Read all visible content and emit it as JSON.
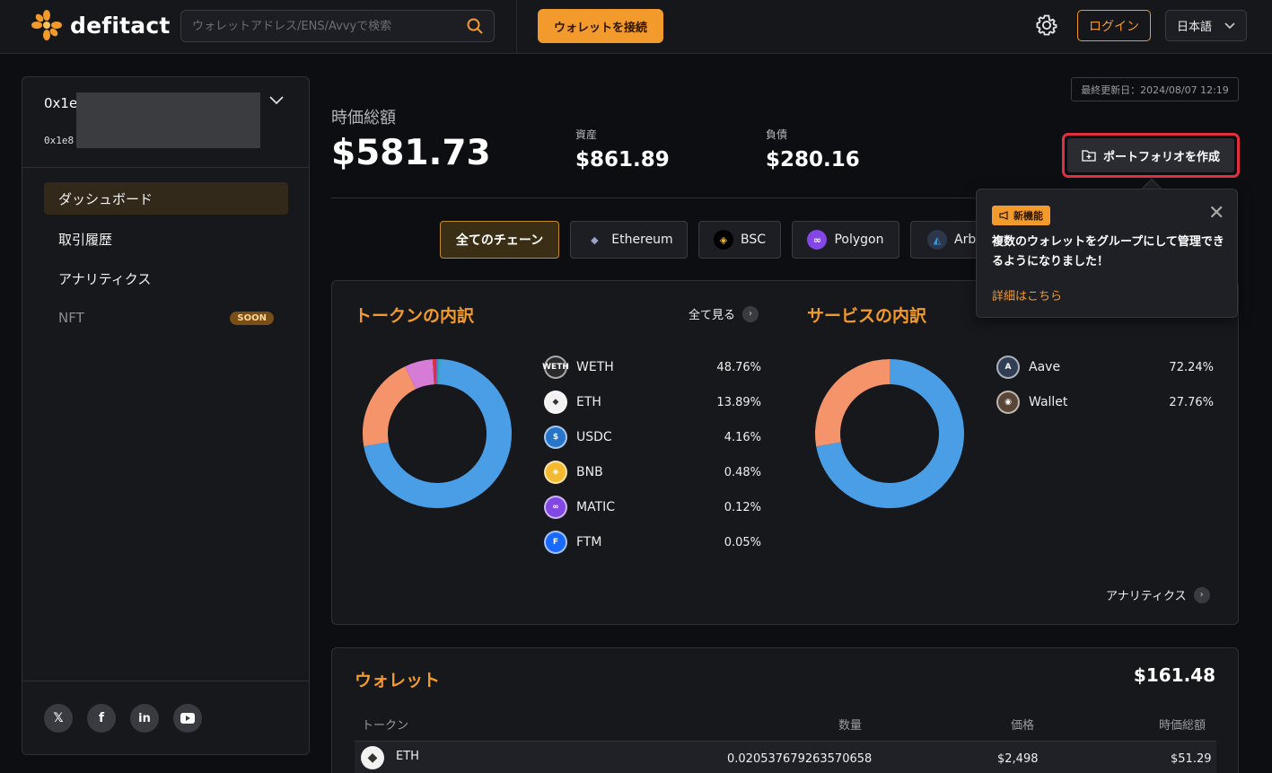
{
  "header": {
    "logo_text": "defitact",
    "search_placeholder": "ウォレットアドレス/ENS/Avvyで検索",
    "connect_label": "ウォレットを接続",
    "login_label": "ログイン",
    "language": "日本語"
  },
  "sidebar": {
    "address_short": "0x1e",
    "address_sub": "0x1e8",
    "items": [
      {
        "label": "ダッシュボード"
      },
      {
        "label": "取引履歴"
      },
      {
        "label": "アナリティクス"
      },
      {
        "label": "NFT",
        "badge": "SOON"
      }
    ],
    "social": [
      "x-icon",
      "facebook-icon",
      "linkedin-icon",
      "youtube-icon"
    ]
  },
  "summary": {
    "last_updated": "最終更新日：2024/08/07 12:19",
    "total_label": "時価総額",
    "total_value": "$581.73",
    "assets_label": "資産",
    "assets_value": "$861.89",
    "liabilities_label": "負債",
    "liabilities_value": "$280.16",
    "create_portfolio": "ポートフォリオを作成"
  },
  "chains": [
    {
      "label": "全てのチェーン",
      "active": true
    },
    {
      "label": "Ethereum",
      "icon": "ethereum-icon"
    },
    {
      "label": "BSC",
      "icon": "bnb-icon"
    },
    {
      "label": "Polygon",
      "icon": "polygon-icon"
    },
    {
      "label": "Arb",
      "icon": "arbitrum-icon"
    }
  ],
  "popup": {
    "badge": "新機能",
    "text": "複数のウォレットをグループにして管理できるようになりました！",
    "link": "詳細はこちら"
  },
  "token_breakdown": {
    "title": "トークンの内訳",
    "see_all": "全て見る",
    "footer_link": "アナリティクス",
    "items": [
      {
        "name": "WETH",
        "pct": "48.76%",
        "icon_text": "WETH",
        "color": "#2b2b2b"
      },
      {
        "name": "ETH",
        "pct": "13.89%",
        "icon_text": "◆",
        "color": "#f2f2f2"
      },
      {
        "name": "USDC",
        "pct": "4.16%",
        "icon_text": "$",
        "color": "#2775ca"
      },
      {
        "name": "BNB",
        "pct": "0.48%",
        "icon_text": "◈",
        "color": "#f3ba2f"
      },
      {
        "name": "MATIC",
        "pct": "0.12%",
        "icon_text": "∞",
        "color": "#8247e5"
      },
      {
        "name": "FTM",
        "pct": "0.05%",
        "icon_text": "F",
        "color": "#1969ff"
      }
    ]
  },
  "service_breakdown": {
    "title": "サービスの内訳",
    "items": [
      {
        "name": "Aave",
        "pct": "72.24%",
        "icon_text": "A",
        "color": "#2f3d55"
      },
      {
        "name": "Wallet",
        "pct": "27.76%",
        "icon_text": "◉",
        "color": "#5a4636"
      }
    ]
  },
  "chart_data": [
    {
      "type": "pie",
      "title": "トークンの内訳",
      "categories": [
        "WETH",
        "ETH",
        "USDC",
        "BNB",
        "MATIC",
        "FTM"
      ],
      "values": [
        48.76,
        13.89,
        4.16,
        0.48,
        0.12,
        0.05
      ],
      "colors": [
        "#4a9ee6",
        "#f5946a",
        "#d67bd6",
        "#e0303f",
        "#8a5cd6",
        "#2bb3a8"
      ]
    },
    {
      "type": "pie",
      "title": "サービスの内訳",
      "categories": [
        "Aave",
        "Wallet"
      ],
      "values": [
        72.24,
        27.76
      ],
      "colors": [
        "#4a9ee6",
        "#f5946a"
      ]
    }
  ],
  "wallet": {
    "title": "ウォレット",
    "total": "$161.48",
    "columns": [
      "トークン",
      "数量",
      "価格",
      "時価総額"
    ],
    "rows": [
      {
        "token": "ETH",
        "amount": "0.020537679263570658",
        "price": "$2,498",
        "value": "$51.29"
      }
    ]
  }
}
